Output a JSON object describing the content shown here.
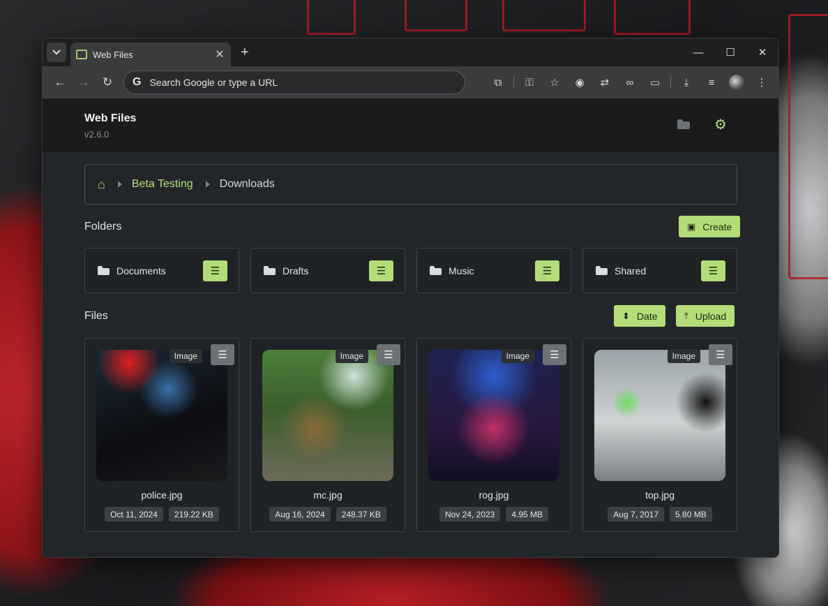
{
  "browser": {
    "tab_title": "Web Files",
    "new_tab": "+",
    "omnibox_placeholder": "Search Google or type a URL",
    "omnibox_g": "G"
  },
  "app": {
    "title": "Web Files",
    "version": "v2.6.0"
  },
  "breadcrumb": {
    "items": [
      "Beta Testing"
    ],
    "current": "Downloads"
  },
  "folders_section": {
    "title": "Folders",
    "create_label": "Create",
    "items": [
      {
        "name": "Documents"
      },
      {
        "name": "Drafts"
      },
      {
        "name": "Music"
      },
      {
        "name": "Shared"
      }
    ]
  },
  "files_section": {
    "title": "Files",
    "sort_label": "Date",
    "upload_label": "Upload",
    "items": [
      {
        "name": "police.jpg",
        "type": "Image",
        "date": "Oct 11, 2024",
        "size": "219.22 KB"
      },
      {
        "name": "mc.jpg",
        "type": "Image",
        "date": "Aug 16, 2024",
        "size": "248.37 KB"
      },
      {
        "name": "rog.jpg",
        "type": "Image",
        "date": "Nov 24, 2023",
        "size": "4.95 MB"
      },
      {
        "name": "top.jpg",
        "type": "Image",
        "date": "Aug 7, 2017",
        "size": "5.80 MB"
      }
    ]
  },
  "colors": {
    "accent": "#b4dc78",
    "app_background": "#222629",
    "header_background": "#191b1d"
  }
}
